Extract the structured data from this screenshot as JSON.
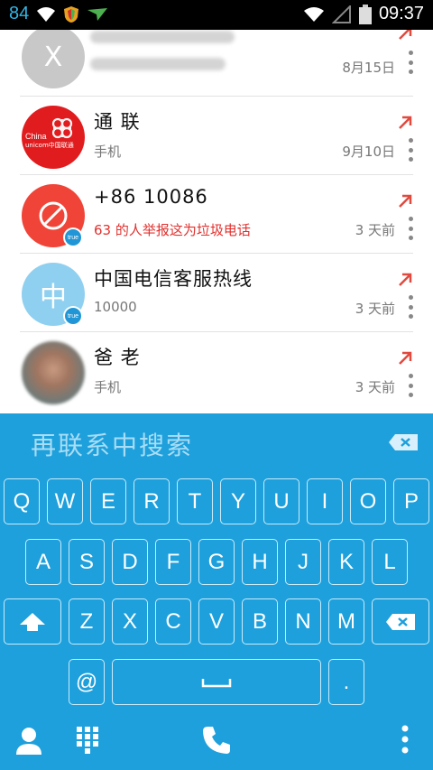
{
  "status_bar": {
    "battery_percent_text": "84",
    "time": "09:37",
    "icons": [
      "wifi-icon",
      "shield-app-icon",
      "plane-app-icon",
      "wifi-signal-icon",
      "no-signal-icon",
      "battery-icon"
    ]
  },
  "calls": [
    {
      "avatar_letter": "X",
      "avatar_color": "#c8c8c8",
      "name": "",
      "sub": "",
      "time": "8月15日",
      "direction": "outgoing"
    },
    {
      "avatar_type": "logo",
      "avatar_color": "#e11c1f",
      "logo_line1": "China",
      "logo_line2": "unicom中国联通",
      "name": "通 联",
      "sub": "手机",
      "time": "9月10日",
      "direction": "outgoing"
    },
    {
      "avatar_type": "blocked",
      "avatar_color": "#f04438",
      "name": "+86 10086",
      "sub": "63 的人举报这为垃圾电话",
      "time": "3 天前",
      "badge": "true",
      "direction": "outgoing"
    },
    {
      "avatar_letter": "中",
      "avatar_color": "#8fd0f0",
      "name": "中国电信客服热线",
      "sub": "10000",
      "time": "3 天前",
      "badge": "true",
      "direction": "outgoing"
    },
    {
      "avatar_type": "photo",
      "name": "爸 老",
      "sub": "手机",
      "time": "3 天前",
      "direction": "outgoing"
    }
  ],
  "search": {
    "text": "再联系中搜索"
  },
  "keyboard": {
    "row1": [
      "Q",
      "W",
      "E",
      "R",
      "T",
      "Y",
      "U",
      "I",
      "O",
      "P"
    ],
    "row2": [
      "A",
      "S",
      "D",
      "F",
      "G",
      "H",
      "J",
      "K",
      "L"
    ],
    "row3": [
      "Z",
      "X",
      "C",
      "V",
      "B",
      "N",
      "M"
    ],
    "at": "@",
    "dot": "."
  },
  "colors": {
    "keyboard_bg": "#1ea0dc",
    "outgoing_arrow": "#e04a3f",
    "spam_text": "#e0312e"
  }
}
